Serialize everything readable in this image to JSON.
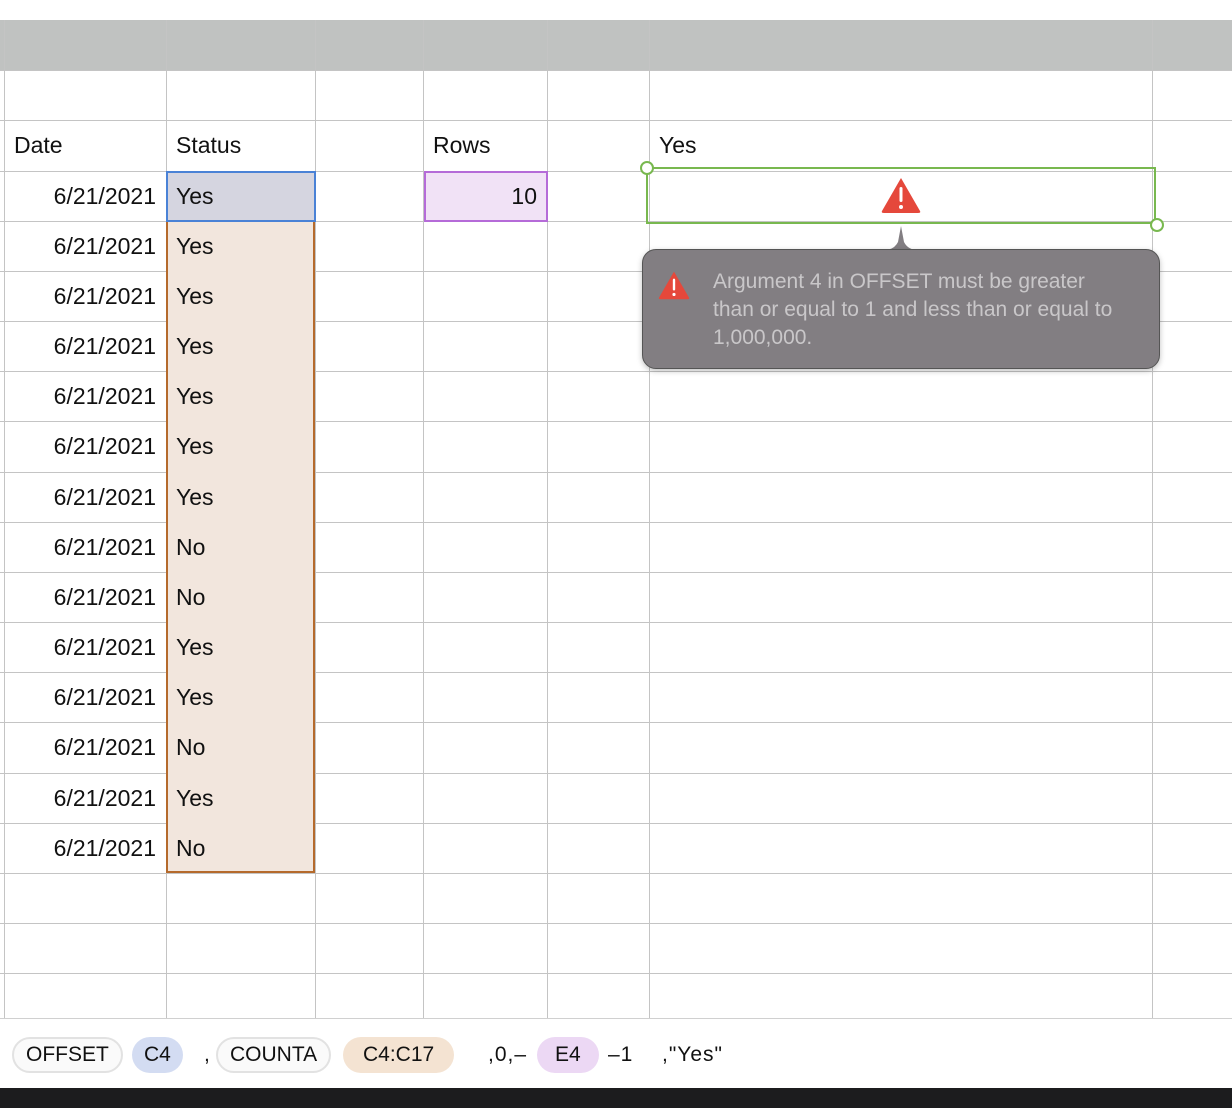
{
  "headers": {
    "date": "Date",
    "status": "Status",
    "rows": "Rows",
    "yes": "Yes"
  },
  "dates": [
    "6/21/2021",
    "6/21/2021",
    "6/21/2021",
    "6/21/2021",
    "6/21/2021",
    "6/21/2021",
    "6/21/2021",
    "6/21/2021",
    "6/21/2021",
    "6/21/2021",
    "6/21/2021",
    "6/21/2021",
    "6/21/2021",
    "6/21/2021"
  ],
  "statuses": [
    "Yes",
    "Yes",
    "Yes",
    "Yes",
    "Yes",
    "Yes",
    "Yes",
    "No",
    "No",
    "Yes",
    "Yes",
    "No",
    "Yes",
    "No"
  ],
  "rows_value": "10",
  "error": {
    "message": "Argument 4 in OFFSET must be greater than or equal to 1 and less than or equal to 1,000,000.",
    "icon": "warning-icon",
    "color": "#e5483b"
  },
  "formula": {
    "fn1": "OFFSET",
    "ref1": "C4",
    "sep1": ",",
    "fn2": "COUNTA",
    "ref2": "C4:C17",
    "mid": ",0,–",
    "ref3": "E4",
    "minus": "–1",
    "tail": ",\"Yes\""
  },
  "colors": {
    "c4": "#d5d5e0",
    "range": "#f2e6dd",
    "e4": "#f1e2f6",
    "selection": "#78b84f"
  }
}
